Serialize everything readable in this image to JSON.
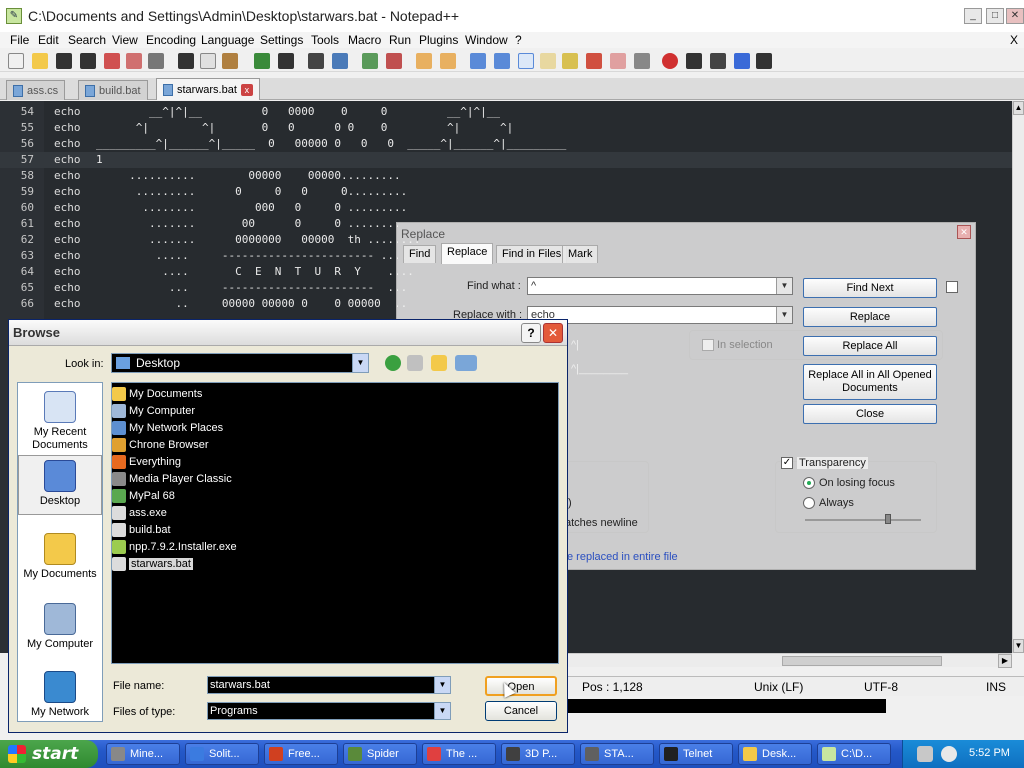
{
  "window": {
    "title": "C:\\Documents and Settings\\Admin\\Desktop\\starwars.bat - Notepad++",
    "minimize": "_",
    "maximize": "□",
    "close": "✕"
  },
  "menu": [
    "File",
    "Edit",
    "Search",
    "View",
    "Encoding",
    "Language",
    "Settings",
    "Tools",
    "Macro",
    "Run",
    "Plugins",
    "Window",
    "?"
  ],
  "menu_close": "X",
  "tabs": [
    {
      "label": "ass.cs",
      "close": "x"
    },
    {
      "label": "build.bat",
      "close": "x"
    },
    {
      "label": "starwars.bat",
      "close": "x"
    }
  ],
  "editor": {
    "lines": [
      {
        "num": "54",
        "keyword": "echo",
        "text": "        __^|^|__         0   0000    0     0         __^|^|__"
      },
      {
        "num": "55",
        "keyword": "echo",
        "text": "      ^|        ^|       0   0      0 0    0         ^|      ^|"
      },
      {
        "num": "56",
        "keyword": "echo",
        "text": "_________^|______^|_____  0   00000 0   0   0  _____^|______^|_________"
      },
      {
        "num": "57",
        "keyword": "echo",
        "text": "1"
      },
      {
        "num": "58",
        "keyword": "echo",
        "text": "     ..........        00000    00000........."
      },
      {
        "num": "59",
        "keyword": "echo",
        "text": "      .........      0     0   0     0........."
      },
      {
        "num": "60",
        "keyword": "echo",
        "text": "       ........         000   0     0 ........."
      },
      {
        "num": "61",
        "keyword": "echo",
        "text": "        .......       00      0     0 ........"
      },
      {
        "num": "62",
        "keyword": "echo",
        "text": "        .......      0000000   00000  th ........"
      },
      {
        "num": "63",
        "keyword": "echo",
        "text": "         .....     ----------------------- ......"
      },
      {
        "num": "64",
        "keyword": "echo",
        "text": "          ....       C  E  N  T  U  R  Y    ...."
      },
      {
        "num": "65",
        "keyword": "echo",
        "text": "           ...     -----------------------  ..."
      },
      {
        "num": "66",
        "keyword": "echo",
        "text": "            ..     00000 00000 0    0 00000  .."
      }
    ],
    "current_line": "57"
  },
  "replace_dialog": {
    "title": "Replace",
    "close": "✕",
    "tabs": [
      "Find",
      "Replace",
      "Find in Files",
      "Mark"
    ],
    "active_tab": "Replace",
    "find_what_label": "Find what :",
    "find_what_value": "^",
    "replace_with_label": "Replace with :",
    "replace_with_value": "echo",
    "in_selection_label": "In selection",
    "buttons": {
      "find_next": "Find Next",
      "replace": "Replace",
      "replace_all": "Replace All",
      "replace_all_opened_line1": "Replace All in All Opened",
      "replace_all_opened_line2": "Documents",
      "close": "Close"
    },
    "transparency_label": "Transparency",
    "transparency_checked": "✓",
    "on_losing_focus_label": "On losing focus",
    "always_label": "Always",
    "partial_option_1": ".)",
    "partial_option_2": "atches newline",
    "status_message": "e replaced in entire file",
    "ghost_text_1": "^|",
    "ghost_text_2": "^|________"
  },
  "browse_dialog": {
    "title": "Browse",
    "help": "?",
    "close": "✕",
    "look_in_label": "Look in:",
    "look_in_value": "Desktop",
    "places": [
      {
        "label_line1": "My Recent",
        "label_line2": "Documents"
      },
      {
        "label_line1": "Desktop",
        "label_line2": ""
      },
      {
        "label_line1": "My Documents",
        "label_line2": ""
      },
      {
        "label_line1": "My Computer",
        "label_line2": ""
      },
      {
        "label_line1": "My Network",
        "label_line2": ""
      }
    ],
    "files": [
      {
        "name": "My Documents",
        "icon_color": "#f3c94a"
      },
      {
        "name": "My Computer",
        "icon_color": "#9fb8d8"
      },
      {
        "name": "My Network Places",
        "icon_color": "#5d8fd0"
      },
      {
        "name": "Chrone Browser",
        "icon_color": "#e0a030"
      },
      {
        "name": "Everything",
        "icon_color": "#e86a20"
      },
      {
        "name": "Media Player Classic",
        "icon_color": "#8a8a8a"
      },
      {
        "name": "MyPal 68",
        "icon_color": "#5aa850"
      },
      {
        "name": "ass.exe",
        "icon_color": "#dcdcdc"
      },
      {
        "name": "build.bat",
        "icon_color": "#dcdcdc"
      },
      {
        "name": "npp.7.9.2.Installer.exe",
        "icon_color": "#9ccc50"
      },
      {
        "name": "starwars.bat",
        "icon_color": "#dcdcdc"
      }
    ],
    "selected_file": "starwars.bat",
    "file_name_label": "File name:",
    "file_name_value": "starwars.bat",
    "file_type_label": "Files of type:",
    "file_type_value": "Programs",
    "open_button": "Open",
    "cancel_button": "Cancel"
  },
  "status_bar": {
    "position": "Pos : 1,128",
    "eol": "Unix (LF)",
    "encoding": "UTF-8",
    "mode": "INS"
  },
  "taskbar": {
    "start_label": "start",
    "items": [
      {
        "label": "Mine...",
        "icon_color": "#888888"
      },
      {
        "label": "Solit...",
        "icon_color": "#3b7be0"
      },
      {
        "label": "Free...",
        "icon_color": "#d04020"
      },
      {
        "label": "Spider",
        "icon_color": "#5a8a3a"
      },
      {
        "label": "The ...",
        "icon_color": "#e04040"
      },
      {
        "label": "3D P...",
        "icon_color": "#404040"
      },
      {
        "label": "STA...",
        "icon_color": "#606060"
      },
      {
        "label": "Telnet",
        "icon_color": "#202020"
      },
      {
        "label": "Desk...",
        "icon_color": "#f3c94a"
      },
      {
        "label": "C:\\D...",
        "icon_color": "#c8e6a0"
      }
    ],
    "clock": "5:52 PM"
  }
}
